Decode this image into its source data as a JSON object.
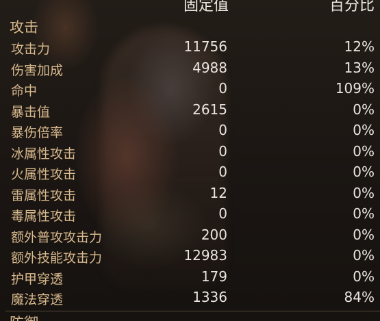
{
  "header": {
    "fixed_label": "固定值",
    "percent_label": "百分比"
  },
  "section_title": "攻击",
  "stats": [
    {
      "name": "攻击力",
      "fixed": "11756",
      "percent": "12%"
    },
    {
      "name": "伤害加成",
      "fixed": "4988",
      "percent": "13%"
    },
    {
      "name": "命中",
      "fixed": "0",
      "percent": "109%"
    },
    {
      "name": "暴击值",
      "fixed": "2615",
      "percent": "0%"
    },
    {
      "name": "暴伤倍率",
      "fixed": "0",
      "percent": "0%"
    },
    {
      "name": "冰属性攻击",
      "fixed": "0",
      "percent": "0%"
    },
    {
      "name": "火属性攻击",
      "fixed": "0",
      "percent": "0%"
    },
    {
      "name": "雷属性攻击",
      "fixed": "12",
      "percent": "0%"
    },
    {
      "name": "毒属性攻击",
      "fixed": "0",
      "percent": "0%"
    },
    {
      "name": "额外普攻攻击力",
      "fixed": "200",
      "percent": "0%"
    },
    {
      "name": "额外技能攻击力",
      "fixed": "12983",
      "percent": "0%"
    },
    {
      "name": "护甲穿透",
      "fixed": "179",
      "percent": "0%"
    },
    {
      "name": "魔法穿透",
      "fixed": "1336",
      "percent": "84%"
    }
  ],
  "next_section_title": "防御"
}
